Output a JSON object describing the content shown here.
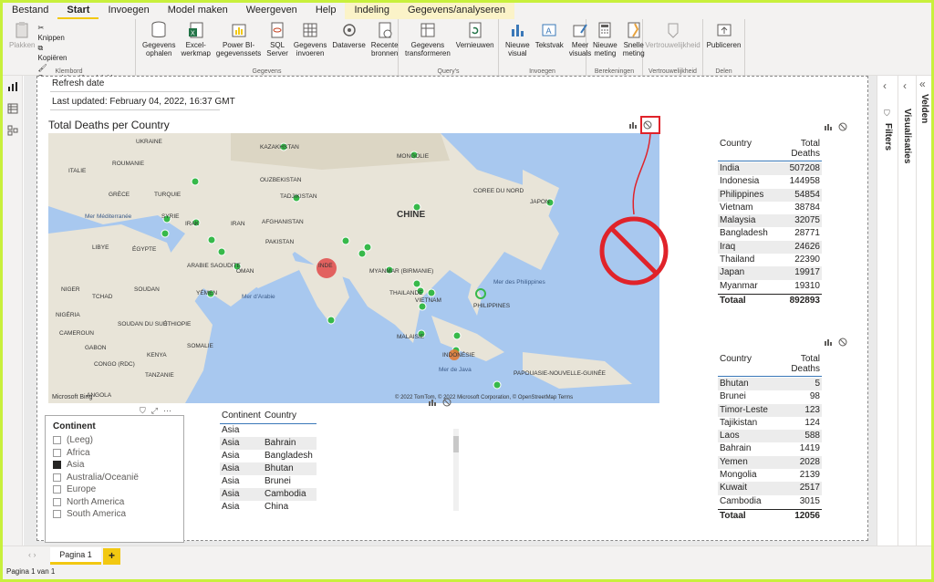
{
  "tabs": [
    "Bestand",
    "Start",
    "Invoegen",
    "Model maken",
    "Weergeven",
    "Help",
    "Indeling",
    "Gegevens/analyseren"
  ],
  "ribbon": {
    "clipboard": {
      "paste": "Plakken",
      "cut": "Knippen",
      "copy": "Kopiëren",
      "format": "Opmaak kopiëren/plakken",
      "label": "Klembord"
    },
    "data": {
      "buttons": [
        "Gegevens ophalen",
        "Excel-werkmap",
        "Power BI-gegevenssets",
        "SQL Server",
        "Gegevens invoeren",
        "Dataverse",
        "Recente bronnen"
      ],
      "label": "Gegevens"
    },
    "queries": {
      "buttons": [
        "Gegevens transformeren",
        "Vernieuwen"
      ],
      "label": "Query's"
    },
    "insert": {
      "buttons": [
        "Nieuwe visual",
        "Tekstvak",
        "Meer visuals"
      ],
      "label": "Invoegen"
    },
    "calc": {
      "buttons": [
        "Nieuwe meting",
        "Snelle meting"
      ],
      "label": "Berekeningen"
    },
    "sensitivity": {
      "buttons": [
        "Vertrouwelijkheid"
      ],
      "label": "Vertrouwelijkheid"
    },
    "share": {
      "buttons": [
        "Publiceren"
      ],
      "label": "Delen"
    }
  },
  "report": {
    "refresh_label": "Refresh date",
    "refresh_value": "Last updated: February 04, 2022, 16:37 GMT",
    "map_title": "Total Deaths per Country",
    "map_footer": "© 2022 TomTom, © 2022 Microsoft Corporation, © OpenStreetMap Terms",
    "map_logo": "Microsoft Bing",
    "map_labels": [
      "UKRAINE",
      "KAZAKHSTAN",
      "MONGOLIE",
      "ROUMANIE",
      "ITALIE",
      "OUZBEKISTAN",
      "GRÈCE",
      "TURQUIE",
      "COREE DU NORD",
      "JAPON",
      "TADJIKISTAN",
      "SYRIE",
      "IRAK",
      "IRAN",
      "AFGHANISTAN",
      "CHINE",
      "Mer Méditerranée",
      "PAKISTAN",
      "LIBYE",
      "ÉGYPTE",
      "ARABIE SAOUDITE",
      "OMAN",
      "INDE",
      "MYANMAR (BIRMANIE)",
      "THAILANDE",
      "VIETNAM",
      "NIGER",
      "TCHAD",
      "SOUDAN",
      "YÉMEN",
      "Mer d'Arabie",
      "Mer des Philippines",
      "PHILIPPINES",
      "NIGÉRIA",
      "SOUDAN DU SUD",
      "ÉTHIOPIE",
      "CAMEROUN",
      "MALAISIE",
      "GABON",
      "KENYA",
      "SOMALIE",
      "INDONÉSIE",
      "CONGO (RDC)",
      "TANZANIE",
      "Mer de Java",
      "PAPOUASIE-NOUVELLE-GUINÉE",
      "ANGOLA"
    ]
  },
  "top_table": {
    "headers": [
      "Country",
      "Total Deaths"
    ],
    "rows": [
      [
        "India",
        "507208"
      ],
      [
        "Indonesia",
        "144958"
      ],
      [
        "Philippines",
        "54854"
      ],
      [
        "Vietnam",
        "38784"
      ],
      [
        "Malaysia",
        "32075"
      ],
      [
        "Bangladesh",
        "28771"
      ],
      [
        "Iraq",
        "24626"
      ],
      [
        "Thailand",
        "22390"
      ],
      [
        "Japan",
        "19917"
      ],
      [
        "Myanmar",
        "19310"
      ]
    ],
    "total_label": "Totaal",
    "total_value": "892893"
  },
  "bottom_table": {
    "headers": [
      "Country",
      "Total Deaths"
    ],
    "rows": [
      [
        "Bhutan",
        "5"
      ],
      [
        "Brunei",
        "98"
      ],
      [
        "Timor-Leste",
        "123"
      ],
      [
        "Tajikistan",
        "124"
      ],
      [
        "Laos",
        "588"
      ],
      [
        "Bahrain",
        "1419"
      ],
      [
        "Yemen",
        "2028"
      ],
      [
        "Mongolia",
        "2139"
      ],
      [
        "Kuwait",
        "2517"
      ],
      [
        "Cambodia",
        "3015"
      ]
    ],
    "total_label": "Totaal",
    "total_value": "12056"
  },
  "slicer": {
    "title": "Continent",
    "items": [
      {
        "label": "(Leeg)",
        "checked": false
      },
      {
        "label": "Africa",
        "checked": false
      },
      {
        "label": "Asia",
        "checked": true
      },
      {
        "label": "Australia/Oceanië",
        "checked": false
      },
      {
        "label": "Europe",
        "checked": false
      },
      {
        "label": "North America",
        "checked": false
      },
      {
        "label": "South America",
        "checked": false
      }
    ]
  },
  "continent_table": {
    "headers": [
      "Continent",
      "Country"
    ],
    "rows": [
      [
        "Asia",
        ""
      ],
      [
        "Asia",
        "Bahrain"
      ],
      [
        "Asia",
        "Bangladesh"
      ],
      [
        "Asia",
        "Bhutan"
      ],
      [
        "Asia",
        "Brunei"
      ],
      [
        "Asia",
        "Cambodia"
      ],
      [
        "Asia",
        "China"
      ]
    ]
  },
  "panes": {
    "filters": "Filters",
    "visualizations": "Visualisaties",
    "fields": "Velden"
  },
  "bottom": {
    "page_tab": "Pagina 1",
    "add": "+",
    "status": "Pagina 1 van 1"
  },
  "colors": {
    "accent": "#f2c811",
    "map_water": "#a8c8ef",
    "land": "#e8e4d8",
    "bubble": "#37b94a",
    "big_bubble": "#e04a4a",
    "annotation": "#e0232a"
  }
}
